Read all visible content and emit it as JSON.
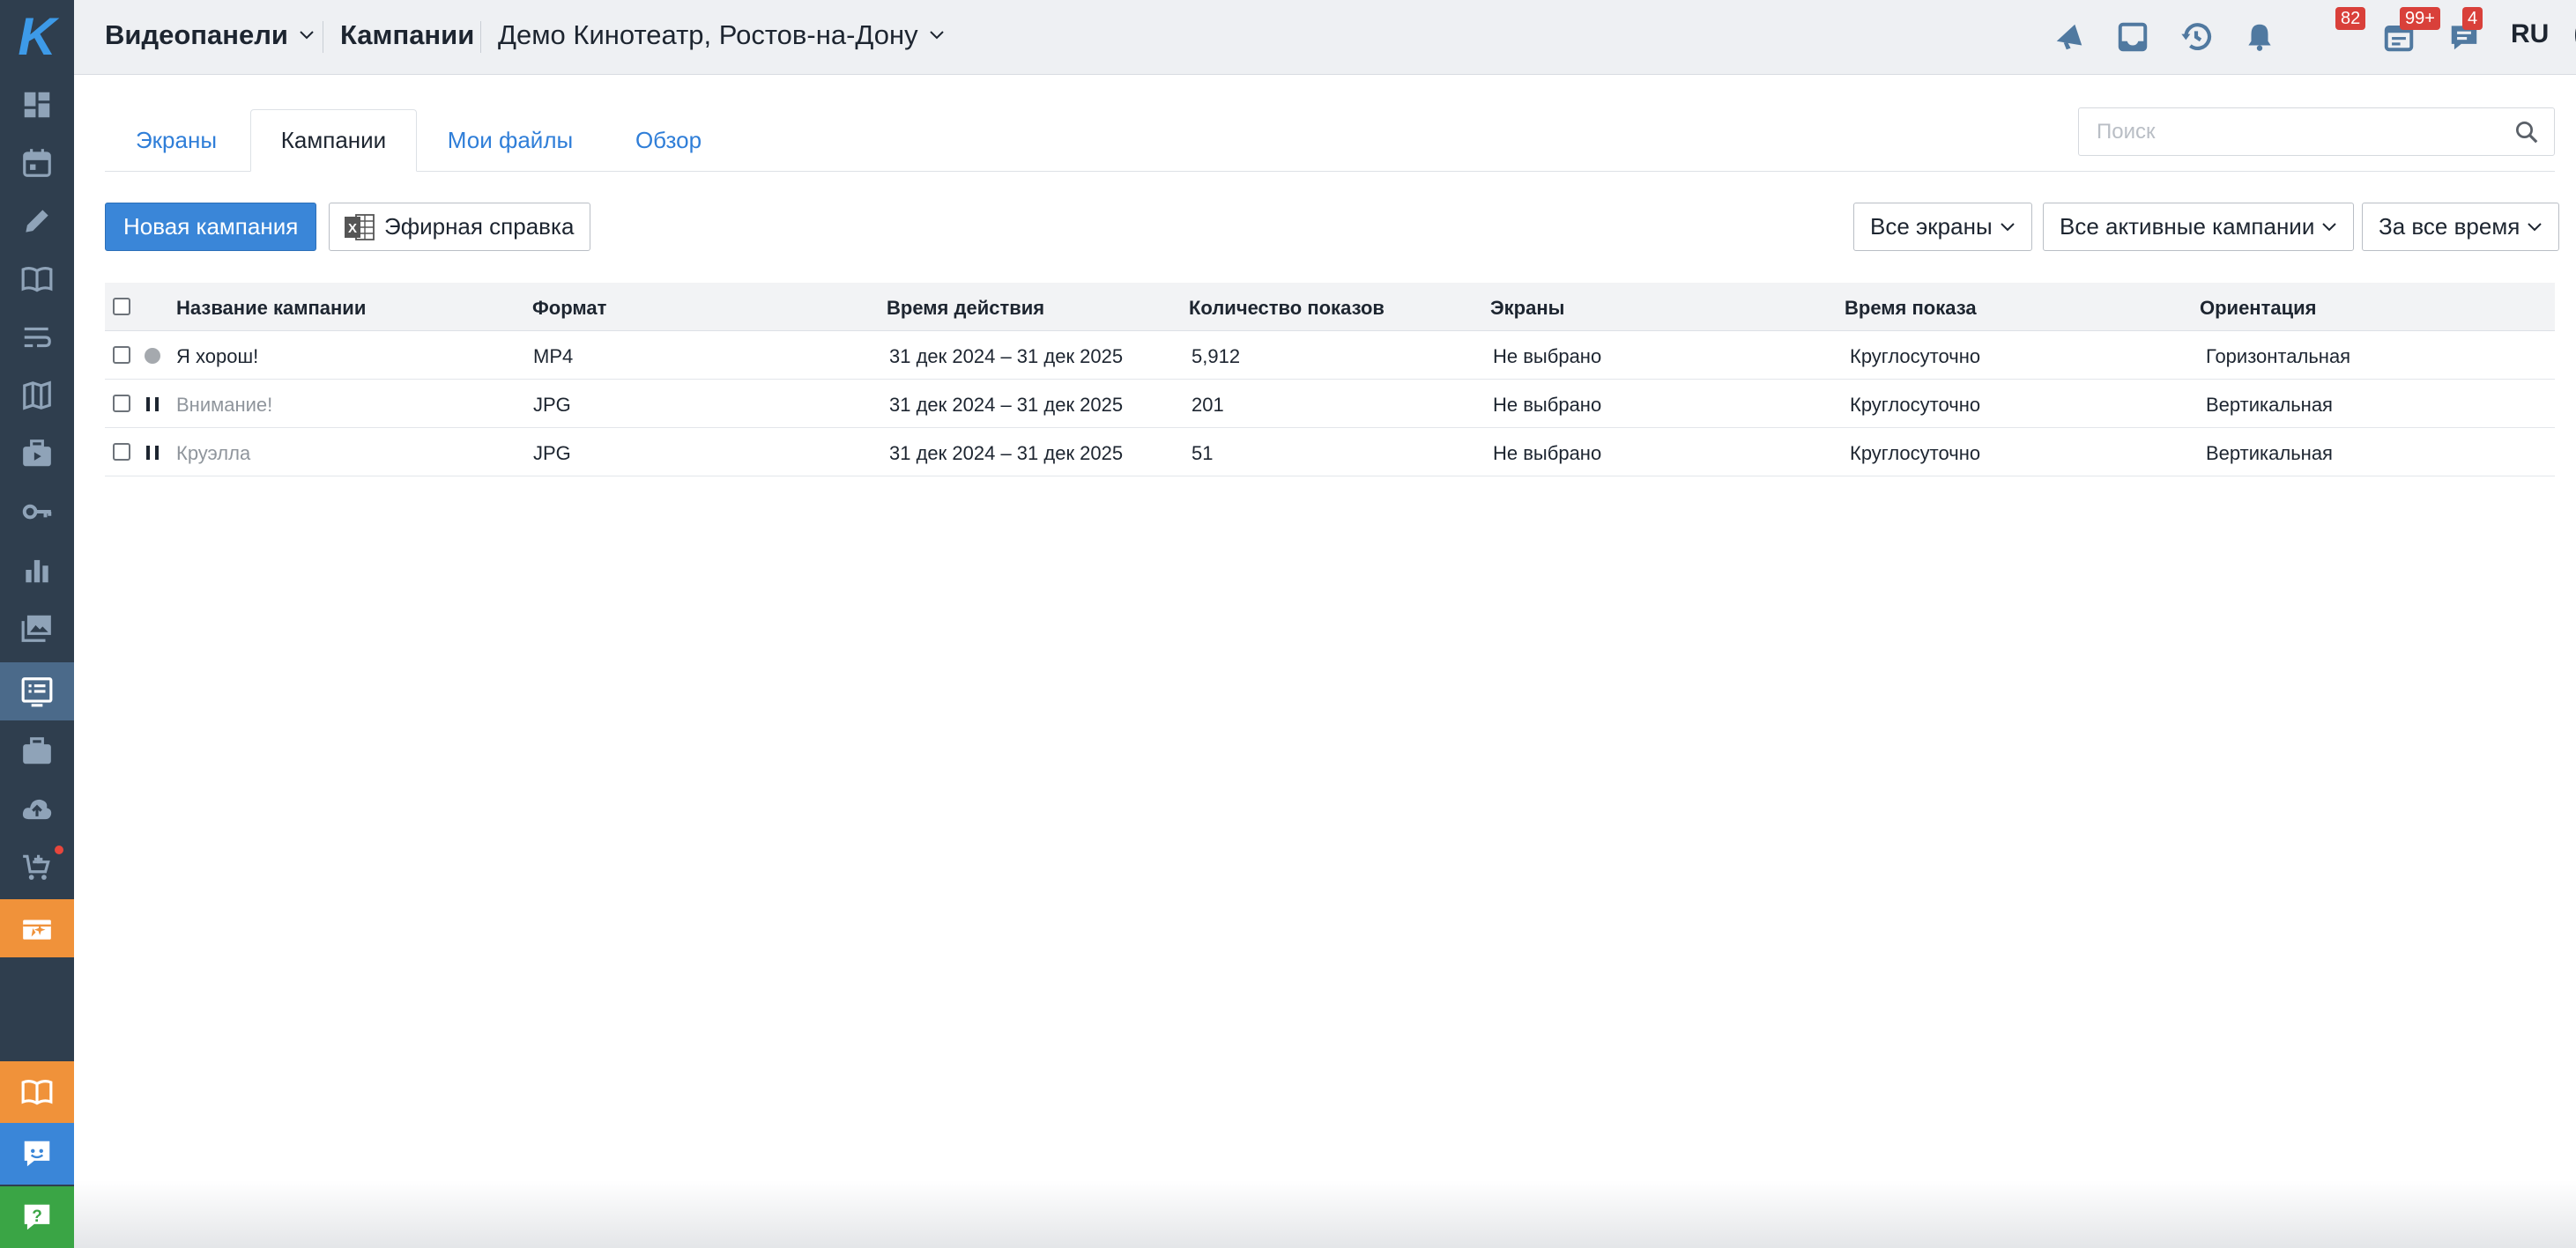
{
  "header": {
    "module": "Видеопанели",
    "section": "Кампании",
    "venue": "Демо Кинотеатр, Ростов-на-Дону",
    "icons": [
      "megaphone-icon",
      "inbox-icon",
      "history-icon",
      "bell-icon",
      "calendar-icon",
      "chat-icon"
    ],
    "badges": {
      "notifications": "82",
      "calendar": "99+",
      "messages": "4"
    },
    "language": "RU"
  },
  "sidebar": {
    "items": [
      "dashboard-icon",
      "calendar-icon",
      "pencil-icon",
      "book-icon",
      "flow-icon",
      "map-icon",
      "video-briefcase-icon",
      "key-icon",
      "bar-chart-icon",
      "gallery-icon",
      "campaigns-list-icon",
      "briefcase-icon",
      "cloud-upload-icon",
      "cart-icon",
      "promo-icon"
    ],
    "bottom": [
      "guide-icon",
      "support-chat-icon",
      "help-icon"
    ]
  },
  "tabs": [
    {
      "label": "Экраны",
      "active": false
    },
    {
      "label": "Кампании",
      "active": true
    },
    {
      "label": "Мои файлы",
      "active": false
    },
    {
      "label": "Обзор",
      "active": false
    }
  ],
  "search": {
    "placeholder": "Поиск",
    "value": ""
  },
  "toolbar": {
    "new_campaign": "Новая кампания",
    "air_report": "Эфирная справка",
    "filter_screens": "Все экраны",
    "filter_campaigns": "Все активные кампании",
    "filter_period": "За все время"
  },
  "table": {
    "columns": [
      "Название кампании",
      "Формат",
      "Время действия",
      "Количество показов",
      "Экраны",
      "Время показа",
      "Ориентация"
    ],
    "rows": [
      {
        "status": "active",
        "name": "Я хорош!",
        "format": "MP4",
        "period": "31 дек 2024 – 31 дек 2025",
        "shows": "5,912",
        "screens": "Не выбрано",
        "time": "Круглосуточно",
        "orientation": "Горизонтальная"
      },
      {
        "status": "paused",
        "name": "Внимание!",
        "format": "JPG",
        "period": "31 дек 2024 – 31 дек 2025",
        "shows": "201",
        "screens": "Не выбрано",
        "time": "Круглосуточно",
        "orientation": "Вертикальная"
      },
      {
        "status": "paused",
        "name": "Круэлла",
        "format": "JPG",
        "period": "31 дек 2024 – 31 дек 2025",
        "shows": "51",
        "screens": "Не выбрано",
        "time": "Круглосуточно",
        "orientation": "Вертикальная"
      }
    ]
  },
  "colors": {
    "sidebar": "#2f3e4e",
    "accent": "#3a86d8",
    "link": "#2f7ed8",
    "badge": "#d9403a",
    "promo": "#f0923a",
    "guide": "#f0923a",
    "support": "#3a86d8",
    "help": "#3aa545"
  }
}
